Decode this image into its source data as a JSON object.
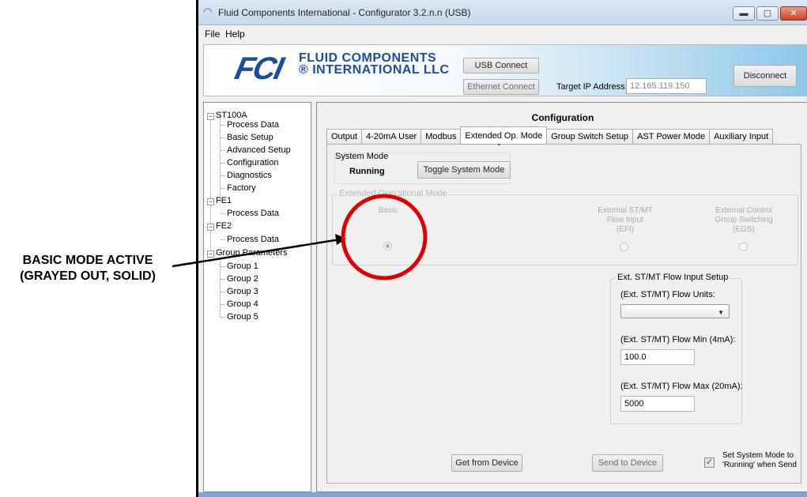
{
  "annotation": {
    "line1": "BASIC MODE ACTIVE",
    "line2": "(GRAYED OUT, SOLID)",
    "circle_color": "#e00000"
  },
  "window": {
    "title": "Fluid Components International - Configurator 3.2.n.n (USB)",
    "controls": [
      "minimize-icon",
      "maximize-icon",
      "close-icon"
    ]
  },
  "menu": [
    "File",
    "Help"
  ],
  "header": {
    "logo_mark": "FCI",
    "company_line1": "FLUID COMPONENTS",
    "company_line2": "® INTERNATIONAL LLC",
    "usb_connect": "USB Connect",
    "ethernet_connect": "Ethernet Connect",
    "target_ip_label": "Target IP Address:",
    "target_ip_value": "12.165.119.150",
    "disconnect": "Disconnect"
  },
  "tree": {
    "root": "ST100A",
    "root_items": [
      "Process Data",
      "Basic Setup",
      "Advanced Setup",
      "Configuration",
      "Diagnostics",
      "Factory"
    ],
    "fe1": "FE1",
    "fe1_items": [
      "Process Data"
    ],
    "fe2": "FE2",
    "fe2_items": [
      "Process Data"
    ],
    "groups": "Group Parameters",
    "group_items": [
      "Group 1",
      "Group 2",
      "Group 3",
      "Group 4",
      "Group 5"
    ]
  },
  "panel": {
    "title": "Configuration",
    "tabs": [
      "Output",
      "4-20mA User",
      "Modbus",
      "Extended Op. Mode",
      "Group Switch Setup",
      "AST Power Mode",
      "Auxiliary Input"
    ],
    "active_tab": "Extended Op. Mode",
    "system_mode": {
      "label": "System Mode",
      "status": "Running",
      "toggle": "Toggle System Mode"
    },
    "ext_mode": {
      "label": "Extended Operational Mode",
      "basic": "Basic",
      "efi_line1": "External ST/MT",
      "efi_line2": "Flow Input",
      "efi_line3": "(EFI)",
      "egs_line1": "External Control",
      "egs_line2": "Group Switching",
      "egs_line3": "(EGS)",
      "selected": "Basic"
    },
    "flow_setup": {
      "label": "Ext. ST/MT Flow Input Setup",
      "units_label": "(Ext. ST/MT) Flow Units:",
      "units_value": "",
      "min_label": "(Ext. ST/MT) Flow Min (4mA):",
      "min_value": "100.0",
      "max_label": "(Ext. ST/MT) Flow Max (20mA):",
      "max_value": "5000"
    },
    "get_from_device": "Get from Device",
    "send_to_device": "Send to Device",
    "set_running_line1": "Set System Mode to",
    "set_running_line2": "'Running' when Send",
    "set_running_checked": true
  }
}
